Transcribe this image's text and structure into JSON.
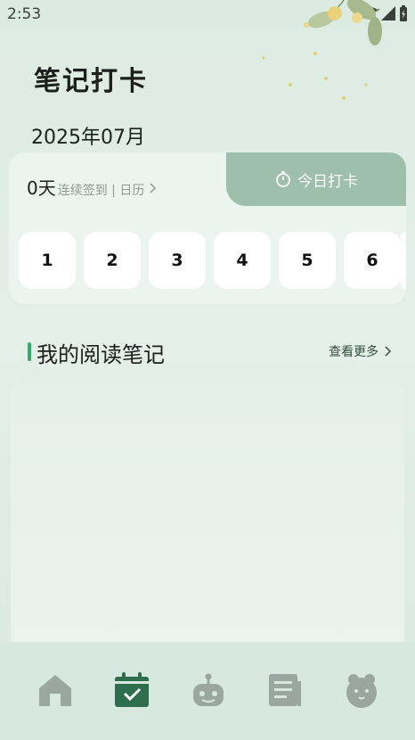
{
  "status": {
    "time": "2:53"
  },
  "header": {
    "title": "笔记打卡",
    "month": "2025年07月"
  },
  "checkin": {
    "streak_count": "0天",
    "streak_label": "连续签到 | 日历",
    "today_button": "今日打卡",
    "days": [
      "1",
      "2",
      "3",
      "4",
      "5",
      "6"
    ]
  },
  "notes": {
    "title": "我的阅读笔记",
    "view_more": "查看更多"
  },
  "colors": {
    "accent_green": "#2fae6b",
    "button_green": "#9ebfab",
    "active_tab": "#2e6e4d",
    "inactive_tab": "#9aa6a0"
  },
  "tabs": [
    {
      "icon": "home-icon"
    },
    {
      "icon": "calendar-check-icon",
      "active": true
    },
    {
      "icon": "robot-icon"
    },
    {
      "icon": "document-icon"
    },
    {
      "icon": "mascot-icon"
    }
  ]
}
